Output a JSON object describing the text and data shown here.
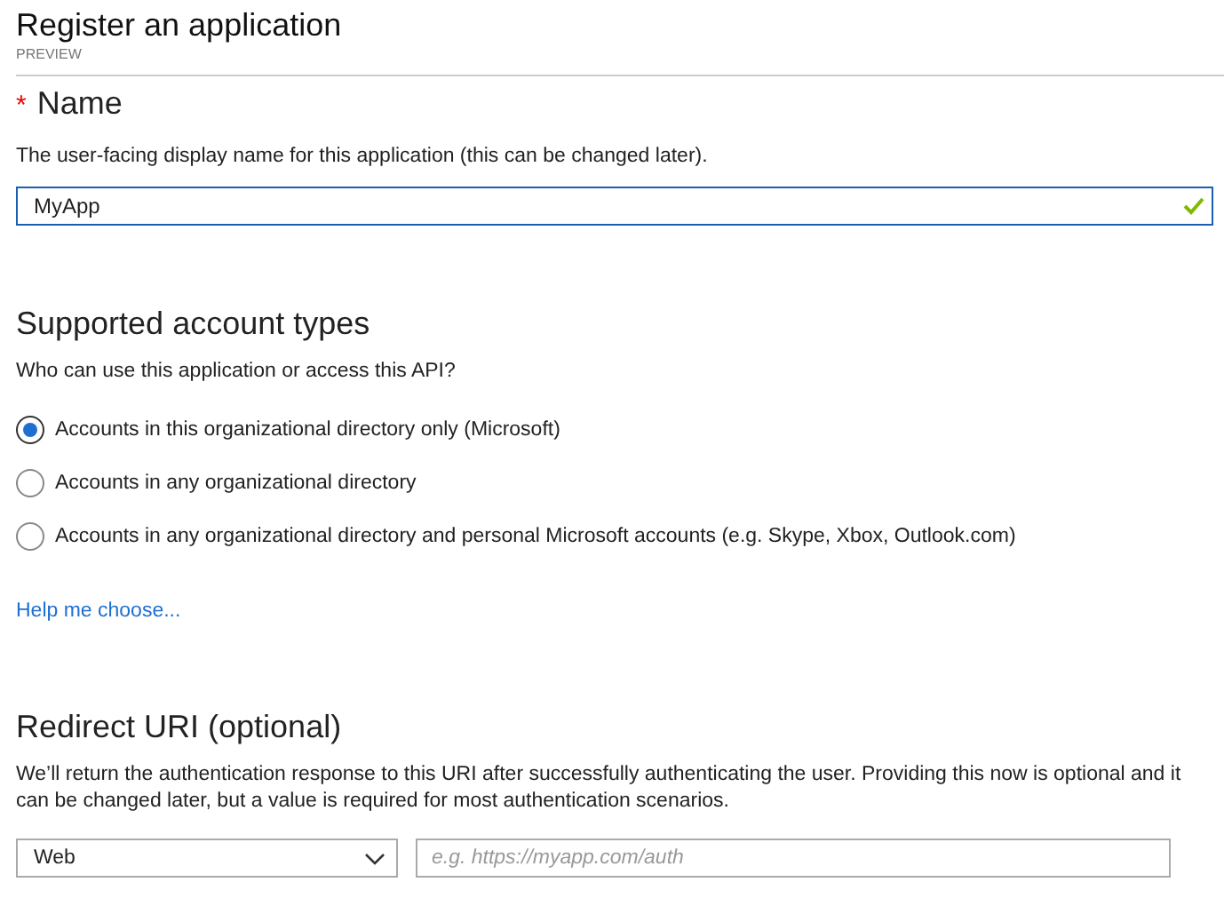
{
  "header": {
    "title": "Register an application",
    "subtitle": "PREVIEW"
  },
  "name_section": {
    "required_mark": "*",
    "heading": "Name",
    "description": "The user-facing display name for this application (this can be changed later).",
    "field": {
      "value": "MyApp",
      "valid": true
    }
  },
  "account_types": {
    "heading": "Supported account types",
    "question": "Who can use this application or access this API?",
    "options": [
      {
        "label": "Accounts in this organizational directory only (Microsoft)",
        "selected": true
      },
      {
        "label": "Accounts in any organizational directory",
        "selected": false
      },
      {
        "label": "Accounts in any organizational directory and personal Microsoft accounts (e.g. Skype, Xbox, Outlook.com)",
        "selected": false
      }
    ],
    "help_link": "Help me choose..."
  },
  "redirect": {
    "heading": "Redirect URI (optional)",
    "description": "We’ll return the authentication response to this URI after successfully authenticating the user. Providing this now is optional and it can be changed later, but a value is required for most authentication scenarios.",
    "platform": "Web",
    "uri_placeholder": "e.g. https://myapp.com/auth"
  }
}
